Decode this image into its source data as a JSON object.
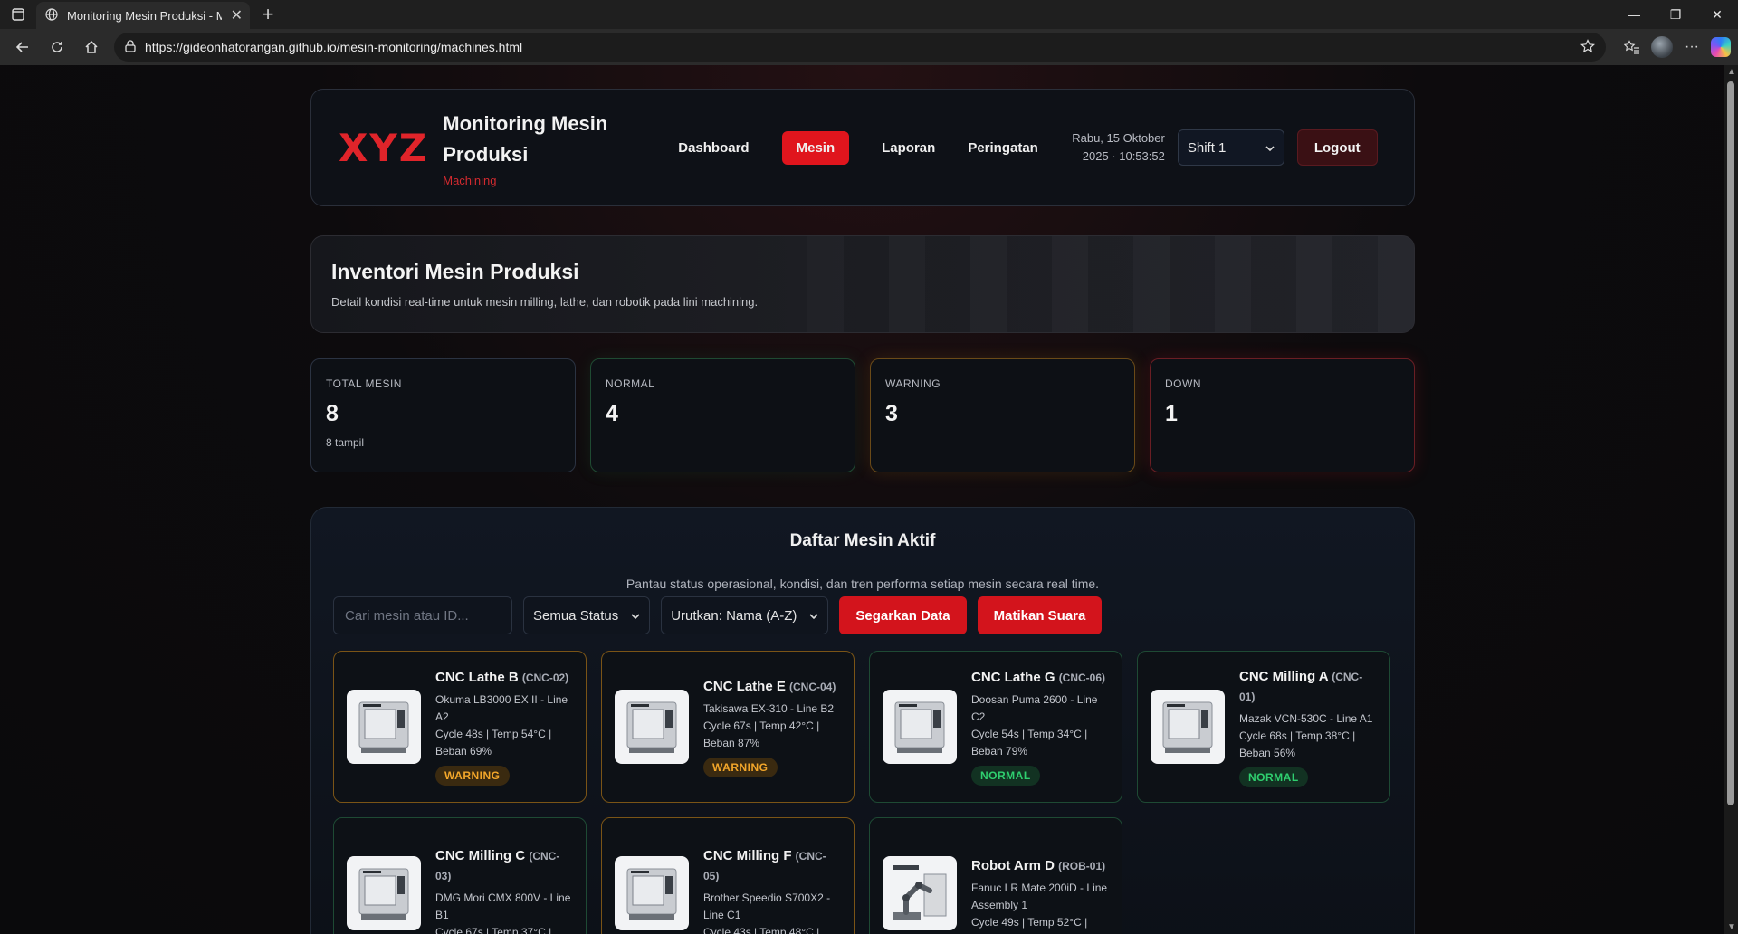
{
  "browser": {
    "tab_title": "Monitoring Mesin Produksi - Mes",
    "url": "https://gideonhatorangan.github.io/mesin-monitoring/machines.html"
  },
  "header": {
    "logo": "XYZ",
    "app_name": "Monitoring Mesin Produksi",
    "subtitle": "Machining",
    "nav": [
      "Dashboard",
      "Mesin",
      "Laporan",
      "Peringatan"
    ],
    "active_nav": "Mesin",
    "date_line1": "Rabu, 15 Oktober",
    "date_line2": "2025 · 10:53:52",
    "shift": "Shift 1",
    "logout": "Logout"
  },
  "hero": {
    "title": "Inventori Mesin Produksi",
    "description": "Detail kondisi real-time untuk mesin milling, lathe, dan robotik pada lini machining."
  },
  "stats": {
    "total": {
      "label": "TOTAL MESIN",
      "value": "8",
      "note": "8 tampil"
    },
    "normal": {
      "label": "NORMAL",
      "value": "4"
    },
    "warning": {
      "label": "WARNING",
      "value": "3"
    },
    "down": {
      "label": "DOWN",
      "value": "1"
    }
  },
  "list": {
    "title": "Daftar Mesin Aktif",
    "description": "Pantau status operasional, kondisi, dan tren performa setiap mesin secara real time.",
    "search_placeholder": "Cari mesin atau ID...",
    "status_filter": "Semua Status",
    "sort": "Urutkan: Nama (A-Z)",
    "refresh_button": "Segarkan Data",
    "mute_button": "Matikan Suara",
    "machines": [
      {
        "name": "CNC Lathe B",
        "code": "(CNC-02)",
        "spec1": "Okuma LB3000 EX II - Line A2",
        "spec2": "Cycle 48s | Temp 54°C | Beban 69%",
        "status": "WARNING"
      },
      {
        "name": "CNC Lathe E",
        "code": "(CNC-04)",
        "spec1": "Takisawa EX-310 - Line B2",
        "spec2": "Cycle 67s | Temp 42°C | Beban 87%",
        "status": "WARNING"
      },
      {
        "name": "CNC Lathe G",
        "code": "(CNC-06)",
        "spec1": "Doosan Puma 2600 - Line C2",
        "spec2": "Cycle 54s | Temp 34°C | Beban 79%",
        "status": "NORMAL"
      },
      {
        "name": "CNC Milling A",
        "code": "(CNC-01)",
        "spec1": "Mazak VCN-530C - Line A1",
        "spec2": "Cycle 68s | Temp 38°C | Beban 56%",
        "status": "NORMAL"
      },
      {
        "name": "CNC Milling C",
        "code": "(CNC-03)",
        "spec1": "DMG Mori CMX 800V - Line B1",
        "spec2": "Cycle 67s | Temp 37°C |",
        "status": ""
      },
      {
        "name": "CNC Milling F",
        "code": "(CNC-05)",
        "spec1": "Brother Speedio S700X2 - Line C1",
        "spec2": "Cycle 43s | Temp 48°C |",
        "status": ""
      },
      {
        "name": "Robot Arm D",
        "code": "(ROB-01)",
        "spec1": "Fanuc LR Mate 200iD - Line Assembly 1",
        "spec2": "Cycle 49s | Temp 52°C |",
        "status": ""
      }
    ]
  },
  "colors": {
    "accent": "#e0151d",
    "warning": "#f2a62a",
    "normal": "#2fcf6f"
  }
}
